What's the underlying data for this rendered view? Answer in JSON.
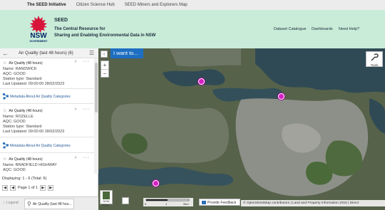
{
  "top_nav": {
    "brand": "The SEED Initiative",
    "links": [
      "Citizen Science Hub",
      "SEED Miners and Explorers Map"
    ]
  },
  "header": {
    "logo_text": "NSW",
    "logo_subtext": "GOVERNMENT",
    "title": "SEED",
    "subtitle_line1": "The Central Resource for",
    "subtitle_line2": "Sharing and Enabling Environmental Data in NSW",
    "nav": [
      "Dataset Catalogue",
      "Dashboards",
      "Need Help?"
    ]
  },
  "panel": {
    "title": "Air Quality (last 48 hours) (6)",
    "records": [
      {
        "title": "Air Quality (48 hours)",
        "name": "Name: RANDWICK",
        "aqc": "AQC: GOOD",
        "station_type": "Station type: Standard",
        "updated": "Last Updated: 09:00:00 28/02/2023"
      },
      {
        "title": "Air Quality (48 hours)",
        "name": "Name: ROZELLE",
        "aqc": "AQC: GOOD",
        "station_type": "Station type: Standard",
        "updated": "Last Updated: 09:00:00 28/02/2023"
      },
      {
        "title": "Air Quality (48 hours)",
        "name": "Name: BRADFIELD HIGHWAY",
        "aqc": "AQC: GOOD"
      }
    ],
    "metadata_label": "Metadata About Air Quality Categories",
    "displaying": "Displaying: 1 - 6 (Total: 6)",
    "pager_text": "Page 1 of 1"
  },
  "taskbar": {
    "legend_label": "Legend",
    "active_tab": "Air Quality (last 48 hou..."
  },
  "map": {
    "i_want_to": "I want to...",
    "tools_label": "Tools",
    "nsw_imagery": "NSW Ima...",
    "scale_labels": [
      "0",
      "1",
      "2km"
    ],
    "feedback": "Provide Feedback",
    "attribution": "© OpenStreetMap contributors | Land and Property Information 2015 | Direct"
  },
  "colors": {
    "header_bg": "#c9ecd9",
    "brand_red": "#d7153a",
    "brand_navy": "#002664",
    "station_marker": "#d51fc4",
    "i_want_to_bg": "#1e6ec2"
  }
}
